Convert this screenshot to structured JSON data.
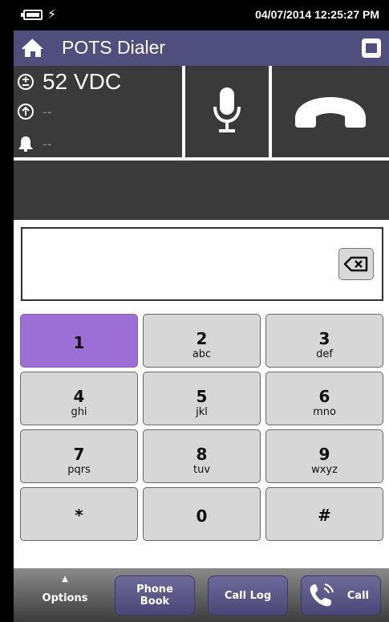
{
  "status_bar": {
    "datetime": "04/07/2014 12:25:27 PM",
    "battery_icon": "battery-icon",
    "charging_icon": "charging-bolt-icon"
  },
  "title_bar": {
    "title": "POTS Dialer",
    "home_icon": "home-icon",
    "network_icon": "network-port-icon"
  },
  "line_status": {
    "voltage": "52 VDC",
    "current": "--",
    "ring": "--",
    "voltage_icon": "plus-minus-circle-icon",
    "current_icon": "arrow-up-circle-icon",
    "ring_icon": "bell-icon"
  },
  "controls": {
    "mic_icon": "microphone-icon",
    "hook_icon": "handset-icon"
  },
  "dial": {
    "number": "",
    "backspace_icon": "backspace-icon"
  },
  "keypad": [
    {
      "digit": "1",
      "letters": "",
      "active": true
    },
    {
      "digit": "2",
      "letters": "abc"
    },
    {
      "digit": "3",
      "letters": "def"
    },
    {
      "digit": "4",
      "letters": "ghi"
    },
    {
      "digit": "5",
      "letters": "jkl"
    },
    {
      "digit": "6",
      "letters": "mno"
    },
    {
      "digit": "7",
      "letters": "pqrs"
    },
    {
      "digit": "8",
      "letters": "tuv"
    },
    {
      "digit": "9",
      "letters": "wxyz"
    },
    {
      "digit": "*",
      "letters": ""
    },
    {
      "digit": "0",
      "letters": ""
    },
    {
      "digit": "#",
      "letters": ""
    }
  ],
  "bottom_bar": {
    "options": "Options",
    "phone_book_line1": "Phone",
    "phone_book_line2": "Book",
    "call_log": "Call Log",
    "call": "Call"
  },
  "colors": {
    "title_bar": "#4f4e7c",
    "active_key": "#9c6fd6",
    "panel": "#3a3a3a"
  }
}
